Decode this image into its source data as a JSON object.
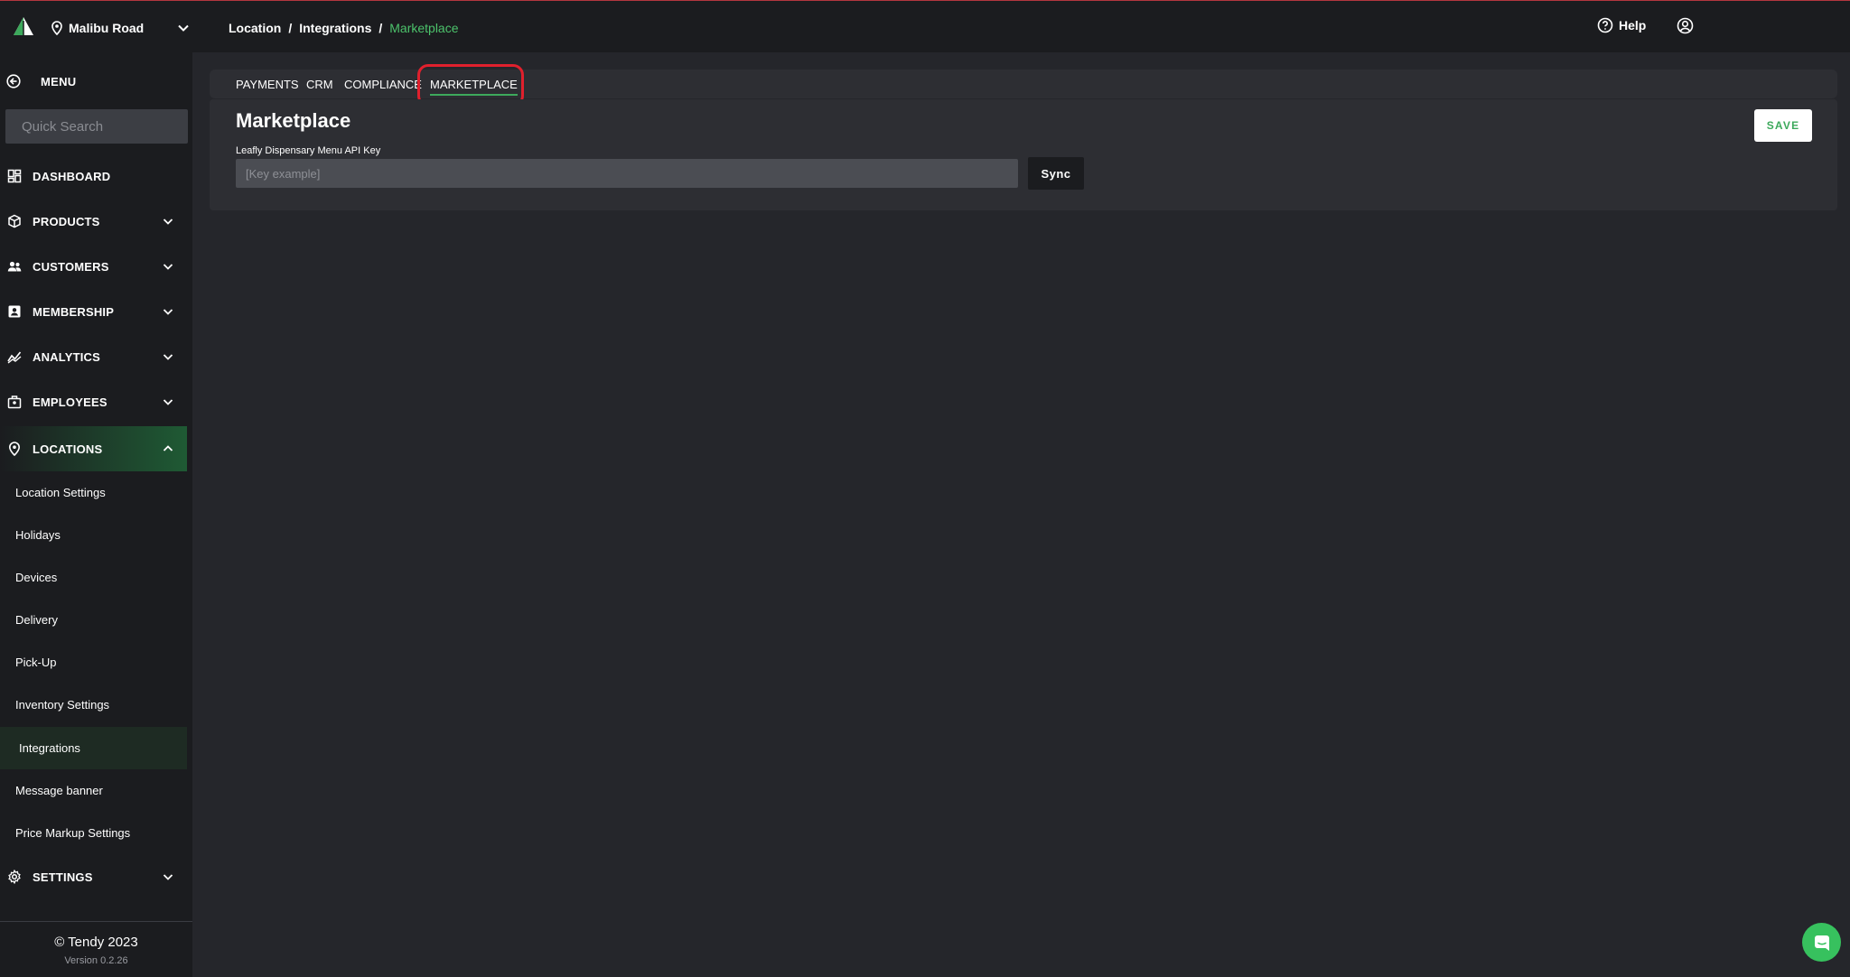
{
  "header": {
    "store": "Malibu Road",
    "breadcrumb": [
      "Location",
      "Integrations",
      "Marketplace"
    ],
    "help_label": "Help"
  },
  "sidebar": {
    "menu_label": "MENU",
    "search_placeholder": "Quick Search",
    "nav": [
      {
        "label": "DASHBOARD",
        "icon": "dashboard-icon"
      },
      {
        "label": "PRODUCTS",
        "icon": "box-icon"
      },
      {
        "label": "CUSTOMERS",
        "icon": "users-icon"
      },
      {
        "label": "MEMBERSHIP",
        "icon": "id-badge-icon"
      },
      {
        "label": "ANALYTICS",
        "icon": "analytics-icon"
      },
      {
        "label": "EMPLOYEES",
        "icon": "briefcase-icon"
      },
      {
        "label": "LOCATIONS",
        "icon": "map-pin-icon"
      },
      {
        "label": "SETTINGS",
        "icon": "gear-icon"
      }
    ],
    "sub_items": [
      "Location Settings",
      "Holidays",
      "Devices",
      "Delivery",
      "Pick-Up",
      "Inventory Settings",
      "Integrations",
      "Message banner",
      "Price Markup Settings"
    ],
    "footer": {
      "copyright": "© Tendy 2023",
      "version": "Version 0.2.26"
    }
  },
  "tabs": [
    "PAYMENTS",
    "CRM",
    "COMPLIANCE",
    "MARKETPLACE"
  ],
  "active_tab": "MARKETPLACE",
  "content": {
    "title": "Marketplace",
    "api_key_label": "Leafly Dispensary Menu API Key",
    "api_key_placeholder": "[Key example]",
    "api_key_value": "",
    "sync_label": "Sync",
    "save_label": "SAVE"
  },
  "colors": {
    "accent": "#3da95c",
    "background": "#25262b",
    "panel": "#2d2e33",
    "sidebar": "#1b1c1f",
    "highlight": "#e0202d"
  }
}
